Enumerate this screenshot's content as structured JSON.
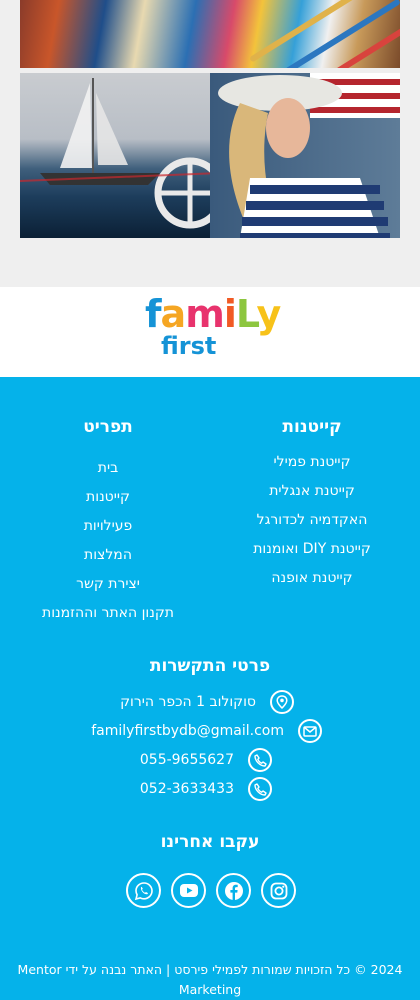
{
  "logo": {
    "word1": [
      "f",
      "a",
      "m",
      "i",
      "L",
      "y"
    ],
    "word1_colors": [
      "#1593d6",
      "#f5a623",
      "#e8336d",
      "#f15a24",
      "#8dc63f",
      "#f7c21a"
    ],
    "word2": "first"
  },
  "footer": {
    "bg_color": "#05b2ea",
    "camps": {
      "title": "קייטנות",
      "items": [
        "קייטנת פמילי",
        "קייטנת אנגלית",
        "האקדמיה לכדורגל",
        "קייטנת DIY ואומנות",
        "קייטנת אופנה"
      ]
    },
    "menu": {
      "title": "תפריט",
      "items": [
        "בית",
        "קייטנות",
        "פעילויות",
        "המלצות",
        "יצירת קשר",
        "תקנון האתר וההזמנות"
      ]
    },
    "contact": {
      "title": "פרטי התקשרות",
      "address": "סוקולוב 1 הכפר הירוק",
      "email": "familyfirstbydb@gmail.com",
      "phone1": "055-9655627",
      "phone2": "052-3633433"
    },
    "follow": {
      "title": "עקבו אחרינו",
      "icons": [
        "instagram-icon",
        "facebook-icon",
        "youtube-icon",
        "whatsapp-icon"
      ]
    },
    "copyright": "2024 © כל הזכויות שמורות לפמילי פירסט | האתר נבנה על ידי Mentor Marketing"
  }
}
